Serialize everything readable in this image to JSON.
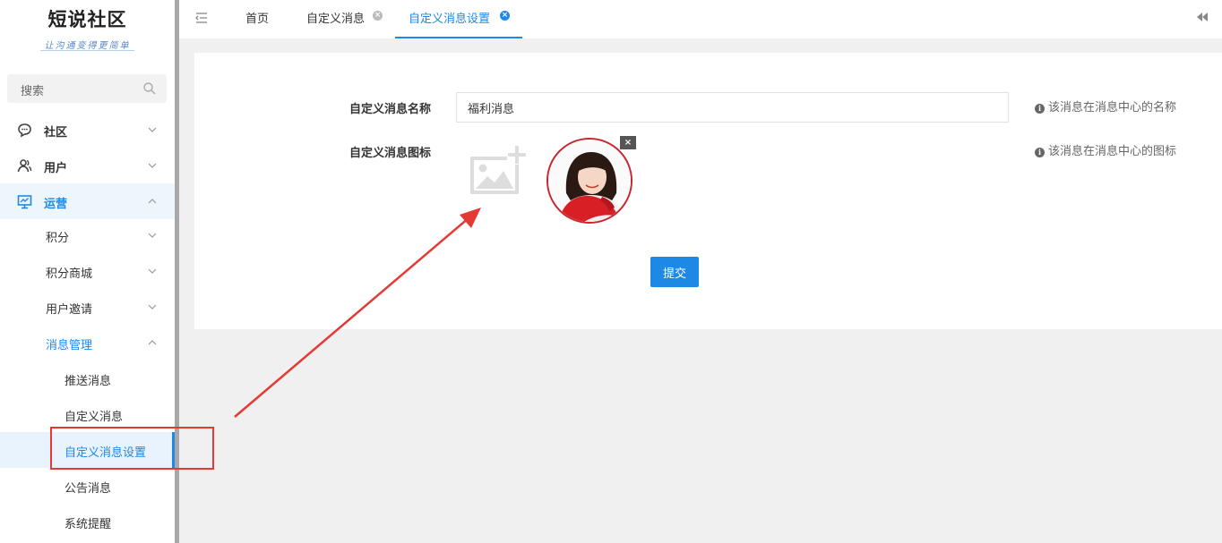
{
  "logo": {
    "title": "短说社区",
    "subtitle": "让沟通变得更简单"
  },
  "sidebar": {
    "search_placeholder": "搜索",
    "items": [
      {
        "label": "社区"
      },
      {
        "label": "用户"
      },
      {
        "label": "运营"
      },
      {
        "label": "积分"
      },
      {
        "label": "积分商城"
      },
      {
        "label": "用户邀请"
      },
      {
        "label": "消息管理"
      },
      {
        "label": "推送消息"
      },
      {
        "label": "自定义消息"
      },
      {
        "label": "自定义消息设置"
      },
      {
        "label": "公告消息"
      },
      {
        "label": "系统提醒"
      }
    ]
  },
  "tabs": [
    {
      "label": "首页"
    },
    {
      "label": "自定义消息"
    },
    {
      "label": "自定义消息设置"
    }
  ],
  "form": {
    "name_label": "自定义消息名称",
    "name_value": "福利消息",
    "name_hint": "该消息在消息中心的名称",
    "icon_label": "自定义消息图标",
    "icon_hint": "该消息在消息中心的图标",
    "submit_label": "提交"
  },
  "colors": {
    "accent": "#1e88e5",
    "annotation": "#e53935",
    "sidebar_scroll": "#a8a8a8"
  }
}
